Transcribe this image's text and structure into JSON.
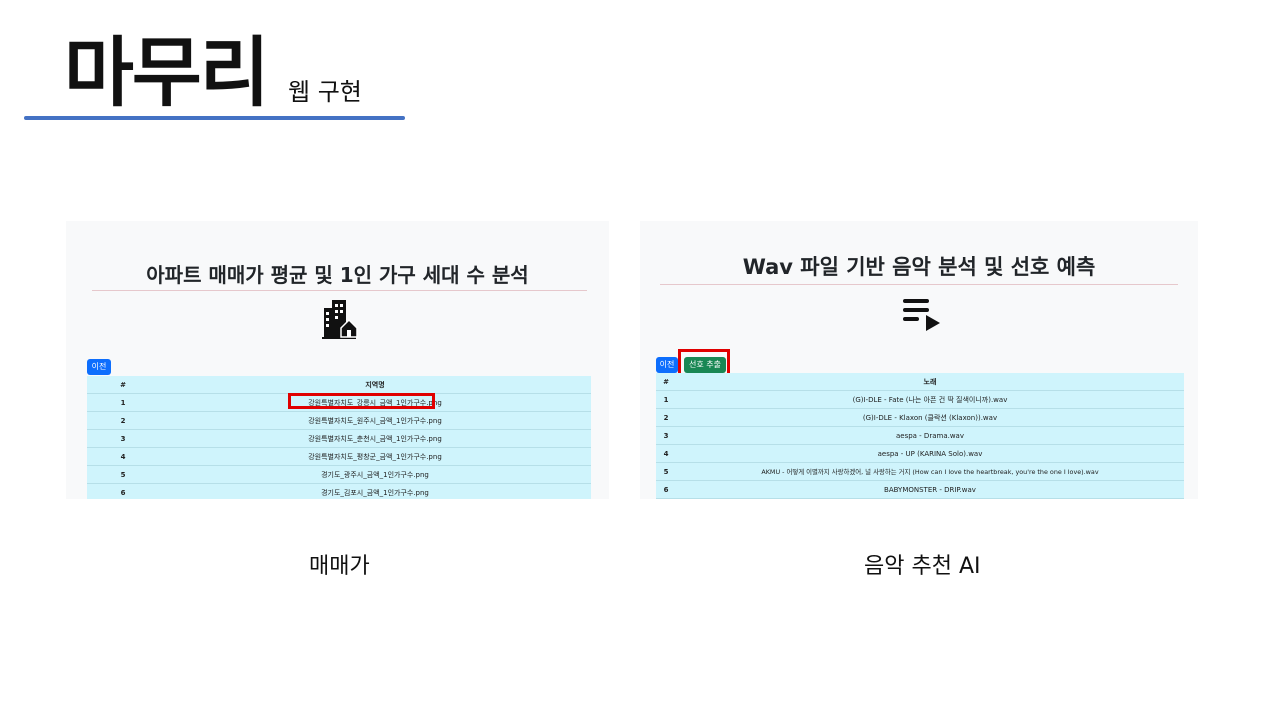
{
  "slide": {
    "title": "마무리",
    "subtitle": "웹 구현"
  },
  "left": {
    "heading": "아파트 매매가 평균 및 1인 가구 세대 수 분석",
    "icon": "city-buildings-icon",
    "prev_button": "이전",
    "table": {
      "headers": [
        "#",
        "지역명"
      ],
      "rows": [
        [
          "1",
          "강원특별자치도_강릉시_금액_1인가구수.png"
        ],
        [
          "2",
          "강원특별자치도_원주시_금액_1인가구수.png"
        ],
        [
          "3",
          "강원특별자치도_춘천시_금액_1인가구수.png"
        ],
        [
          "4",
          "강원특별자치도_평창군_금액_1인가구수.png"
        ],
        [
          "5",
          "경기도_광주시_금액_1인가구수.png"
        ],
        [
          "6",
          "경기도_김포시_금액_1인가구수.png"
        ]
      ]
    },
    "caption": "매매가"
  },
  "right": {
    "heading": "Wav 파일 기반 음악 분석 및 선호 예측",
    "icon": "playlist-play-icon",
    "prev_button": "이전",
    "extract_button": "선호 추출",
    "table": {
      "headers": [
        "#",
        "노래"
      ],
      "rows": [
        [
          "1",
          "(G)I-DLE - Fate (나는 아픈 건 딱 질색이니까).wav"
        ],
        [
          "2",
          "(G)I-DLE - Klaxon (클락션 (Klaxon)).wav"
        ],
        [
          "3",
          "aespa - Drama.wav"
        ],
        [
          "4",
          "aespa - UP (KARINA Solo).wav"
        ],
        [
          "5",
          "AKMU - 어떻게 이별까지 사랑하겠어, 널 사랑하는 거지 (How can I love the heartbreak, you're the one I love).wav"
        ],
        [
          "6",
          "BABYMONSTER - DRIP.wav"
        ]
      ]
    },
    "caption": "음악 추천 AI"
  },
  "colors": {
    "accent_line": "#4472c4",
    "highlight": "#e00000",
    "table_bg": "#cff4fc",
    "primary": "#0d6efd",
    "success": "#198754"
  }
}
